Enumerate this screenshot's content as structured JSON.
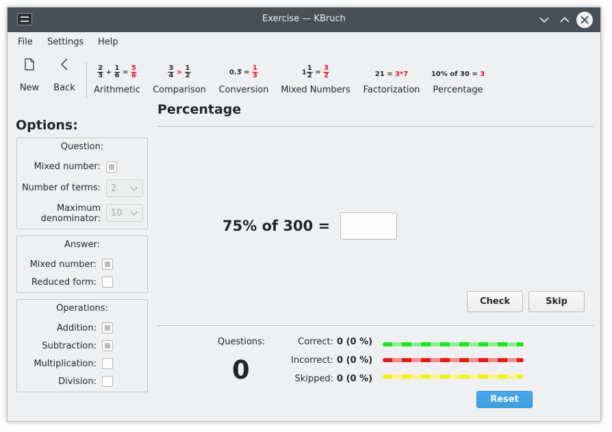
{
  "window": {
    "title": "Exercise — KBruch"
  },
  "menu": [
    "File",
    "Settings",
    "Help"
  ],
  "toolbar": {
    "new_label": "New",
    "back_label": "Back",
    "tools": [
      {
        "label": "Arithmetic",
        "icon": {
          "a_n": "2",
          "a_d": "3",
          "op": "+",
          "b_n": "1",
          "b_d": "6",
          "eq": "=",
          "r_n": "5",
          "r_d": "6"
        }
      },
      {
        "label": "Comparison",
        "icon": {
          "a_n": "3",
          "a_d": "4",
          "op": ">",
          "b_n": "1",
          "b_d": "2"
        }
      },
      {
        "label": "Conversion",
        "icon": {
          "left": "0.3̅",
          "eq": "=",
          "r_n": "1",
          "r_d": "3"
        }
      },
      {
        "label": "Mixed Numbers",
        "icon": {
          "whole": "1",
          "a_n": "1",
          "a_d": "2",
          "eq": "=",
          "r_n": "3",
          "r_d": "2"
        }
      },
      {
        "label": "Factorization",
        "icon": {
          "left": "21 =",
          "right": "3*7"
        }
      },
      {
        "label": "Percentage",
        "icon": {
          "left": "10% of 30 =",
          "right": "3"
        }
      }
    ]
  },
  "options": {
    "title": "Options:",
    "question": {
      "title": "Question:",
      "mixed_number_label": "Mixed number:",
      "mixed_number_checked": true,
      "terms_label": "Number of terms:",
      "terms_value": "2",
      "maxden_label_1": "Maximum",
      "maxden_label_2": "denominator:",
      "maxden_value": "10"
    },
    "answer": {
      "title": "Answer:",
      "mixed_number_label": "Mixed number:",
      "mixed_number_checked": true,
      "reduced_label": "Reduced form:",
      "reduced_checked": false
    },
    "operations": {
      "title": "Operations:",
      "addition_label": "Addition:",
      "addition_checked": true,
      "subtraction_label": "Subtraction:",
      "subtraction_checked": true,
      "multiplication_label": "Multiplication:",
      "multiplication_checked": false,
      "division_label": "Division:",
      "division_checked": false
    }
  },
  "exercise": {
    "title": "Percentage",
    "question": "75% of 300 =",
    "answer_value": "",
    "check_label": "Check",
    "skip_label": "Skip"
  },
  "stats": {
    "questions_label": "Questions:",
    "questions_count": "0",
    "correct_label": "Correct:",
    "correct_value": "0 (0 %)",
    "incorrect_label": "Incorrect:",
    "incorrect_value": "0 (0 %)",
    "skipped_label": "Skipped:",
    "skipped_value": "0 (0 %)",
    "reset_label": "Reset",
    "colors": {
      "correct": "#19e619",
      "incorrect": "#e61919",
      "skipped": "#f0f019"
    }
  }
}
